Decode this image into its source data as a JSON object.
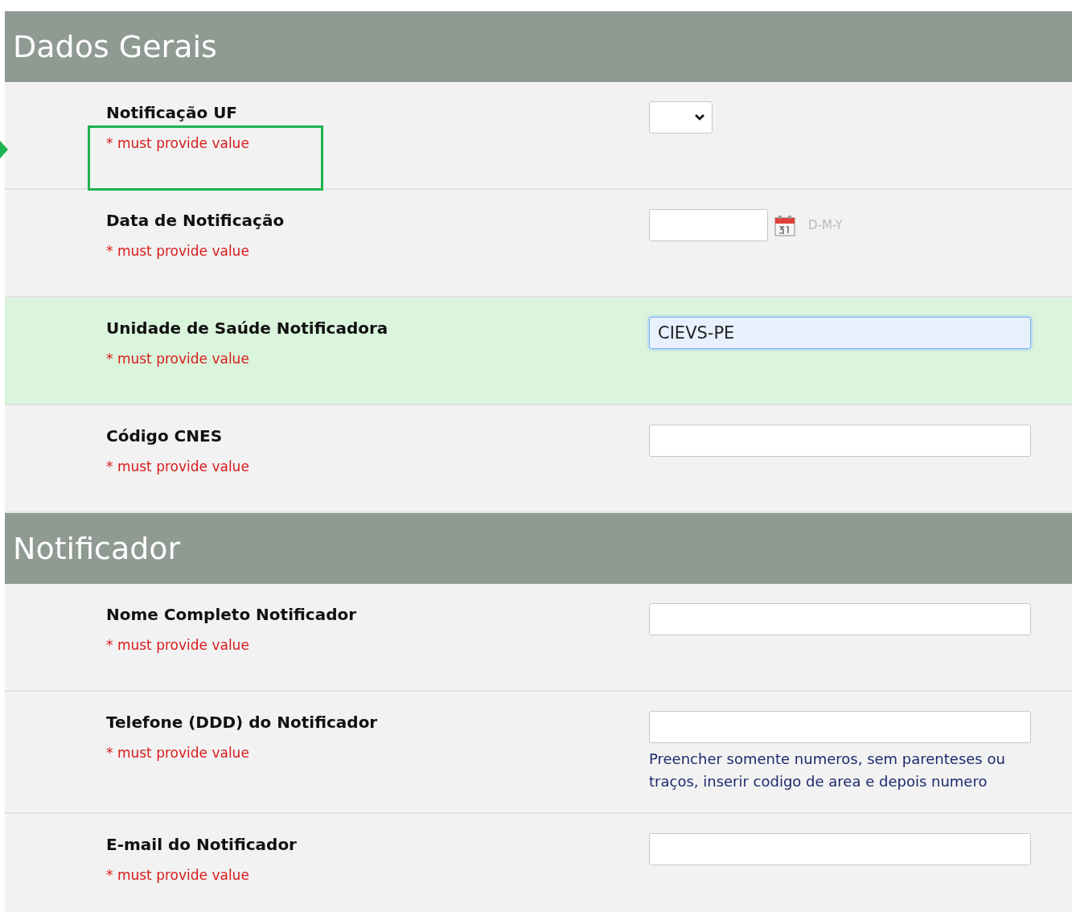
{
  "sections": [
    {
      "title": "Dados Gerais",
      "fields": [
        {
          "label": "Notificação UF",
          "required": "* must provide value",
          "kind": "select",
          "highlighted": false,
          "annotated": true
        },
        {
          "label": "Data de Notificação",
          "required": "* must provide value",
          "kind": "date",
          "format": "D-M-Y",
          "highlighted": false,
          "annotated": false
        },
        {
          "label": "Unidade de Saúde Notificadora",
          "required": "* must provide value",
          "kind": "text",
          "value": "CIEVS-PE",
          "focused": true,
          "highlighted": true,
          "annotated": false
        },
        {
          "label": "Código CNES",
          "required": "* must provide value",
          "kind": "text",
          "focused": false,
          "highlighted": false,
          "annotated": false
        }
      ]
    },
    {
      "title": "Notificador",
      "fields": [
        {
          "label": "Nome Completo Notificador",
          "required": "* must provide value",
          "kind": "text",
          "focused": false,
          "highlighted": false,
          "annotated": false
        },
        {
          "label": "Telefone (DDD) do Notificador",
          "required": "* must provide value",
          "kind": "text",
          "focused": false,
          "note": "Preencher somente numeros, sem parenteses ou traços, inserir codigo de area e depois numero",
          "highlighted": false,
          "annotated": false
        },
        {
          "label": "E-mail do Notificador",
          "required": "* must provide value",
          "kind": "text",
          "focused": false,
          "highlighted": false,
          "annotated": false
        }
      ]
    }
  ]
}
